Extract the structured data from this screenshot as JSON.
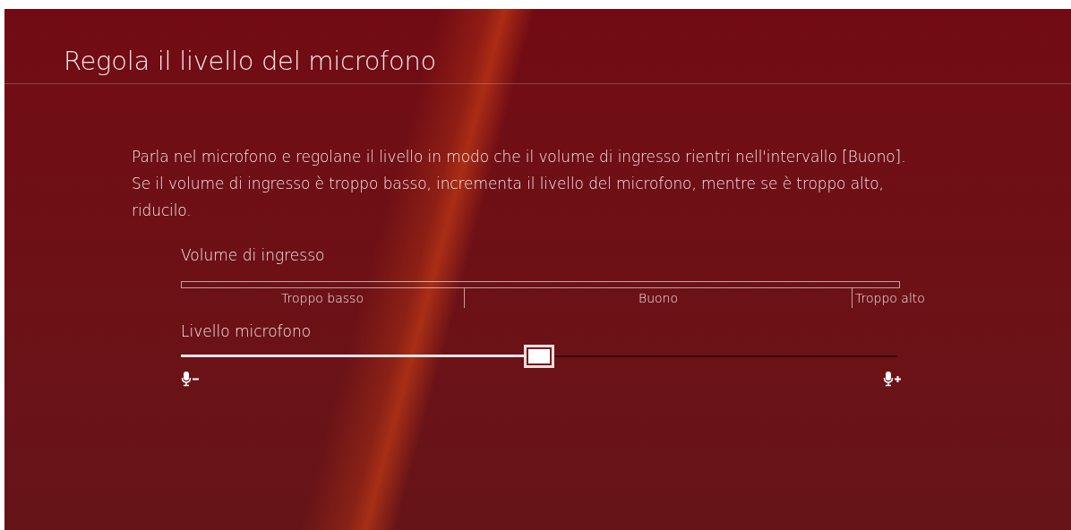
{
  "title": "Regola il livello del microfono",
  "instructions": [
    "Parla nel microfono e regolane il livello in modo che il volume di ingresso rientri nell'intervallo [Buono].",
    "Se il volume di ingresso è troppo basso, incrementa il livello del microfono, mentre se è troppo alto, riducilo."
  ],
  "input_volume": {
    "label": "Volume di ingresso",
    "level": 0,
    "ranges": [
      "Troppo basso",
      "Buono",
      "Troppo alto"
    ]
  },
  "mic_level": {
    "label": "Livello microfono",
    "level": 0.5
  }
}
